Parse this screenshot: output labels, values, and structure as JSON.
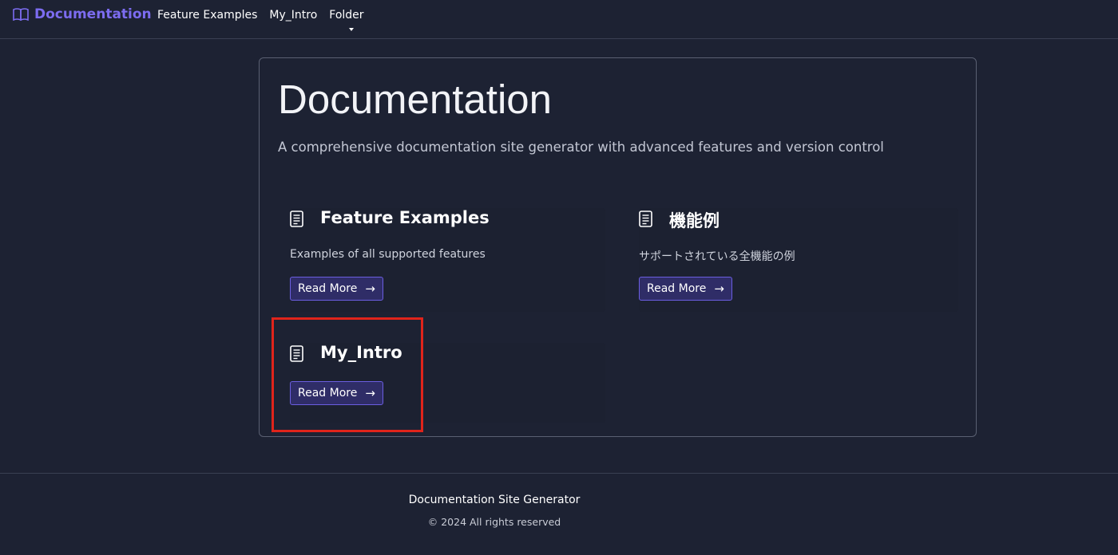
{
  "nav": {
    "brand": "Documentation",
    "links": [
      "Feature Examples",
      "My_Intro",
      "Folder"
    ]
  },
  "hero": {
    "title": "Documentation",
    "subtitle": "A comprehensive documentation site generator with advanced features and version control"
  },
  "cards": [
    {
      "title": "Feature Examples",
      "description": "Examples of all supported features",
      "button": "Read More",
      "icon": "document-icon"
    },
    {
      "title": "機能例",
      "description": "サポートされている全機能の例",
      "button": "Read More",
      "icon": "document-icon"
    },
    {
      "title": "My_Intro",
      "description": "",
      "button": "Read More",
      "icon": "document-icon"
    }
  ],
  "footer": {
    "title": "Documentation Site Generator",
    "copyright": "© 2024 All rights reserved"
  },
  "colors": {
    "background": "#1d2233",
    "brand": "#7c6cf0",
    "button_bg": "#2f2d67",
    "button_border": "#6b5ee0",
    "highlight": "#e0241b"
  }
}
